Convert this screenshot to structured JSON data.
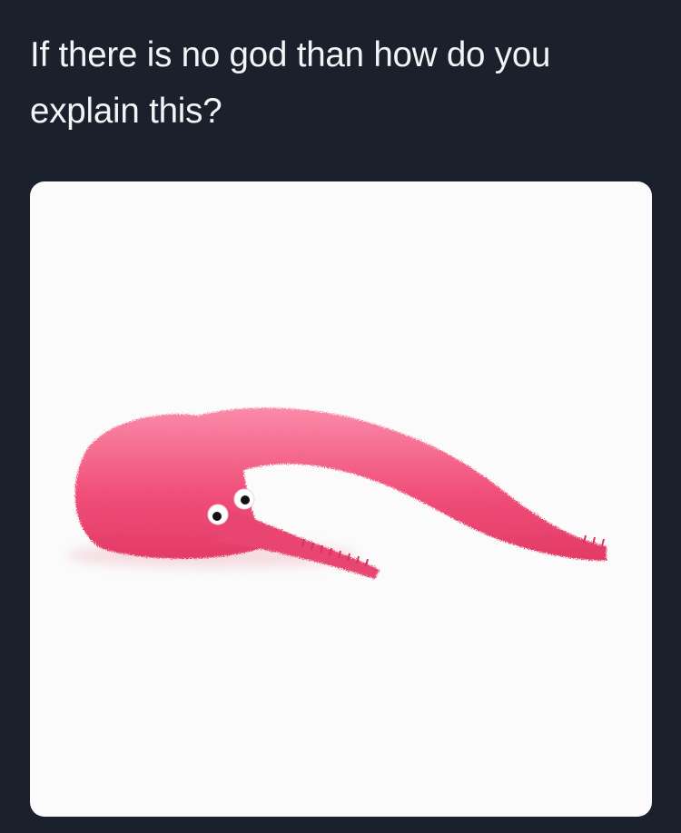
{
  "tweet": {
    "text": "If there is no god than how do you explain this?"
  },
  "media": {
    "subject": "pink fuzzy worm on a string toy with googly eyes",
    "background_color": "#fbfbfb",
    "worm_color": "#f0507a",
    "worm_highlight_color": "#fa8aa8"
  },
  "colors": {
    "page_background": "#1a202c",
    "text": "#f3f4f6"
  }
}
